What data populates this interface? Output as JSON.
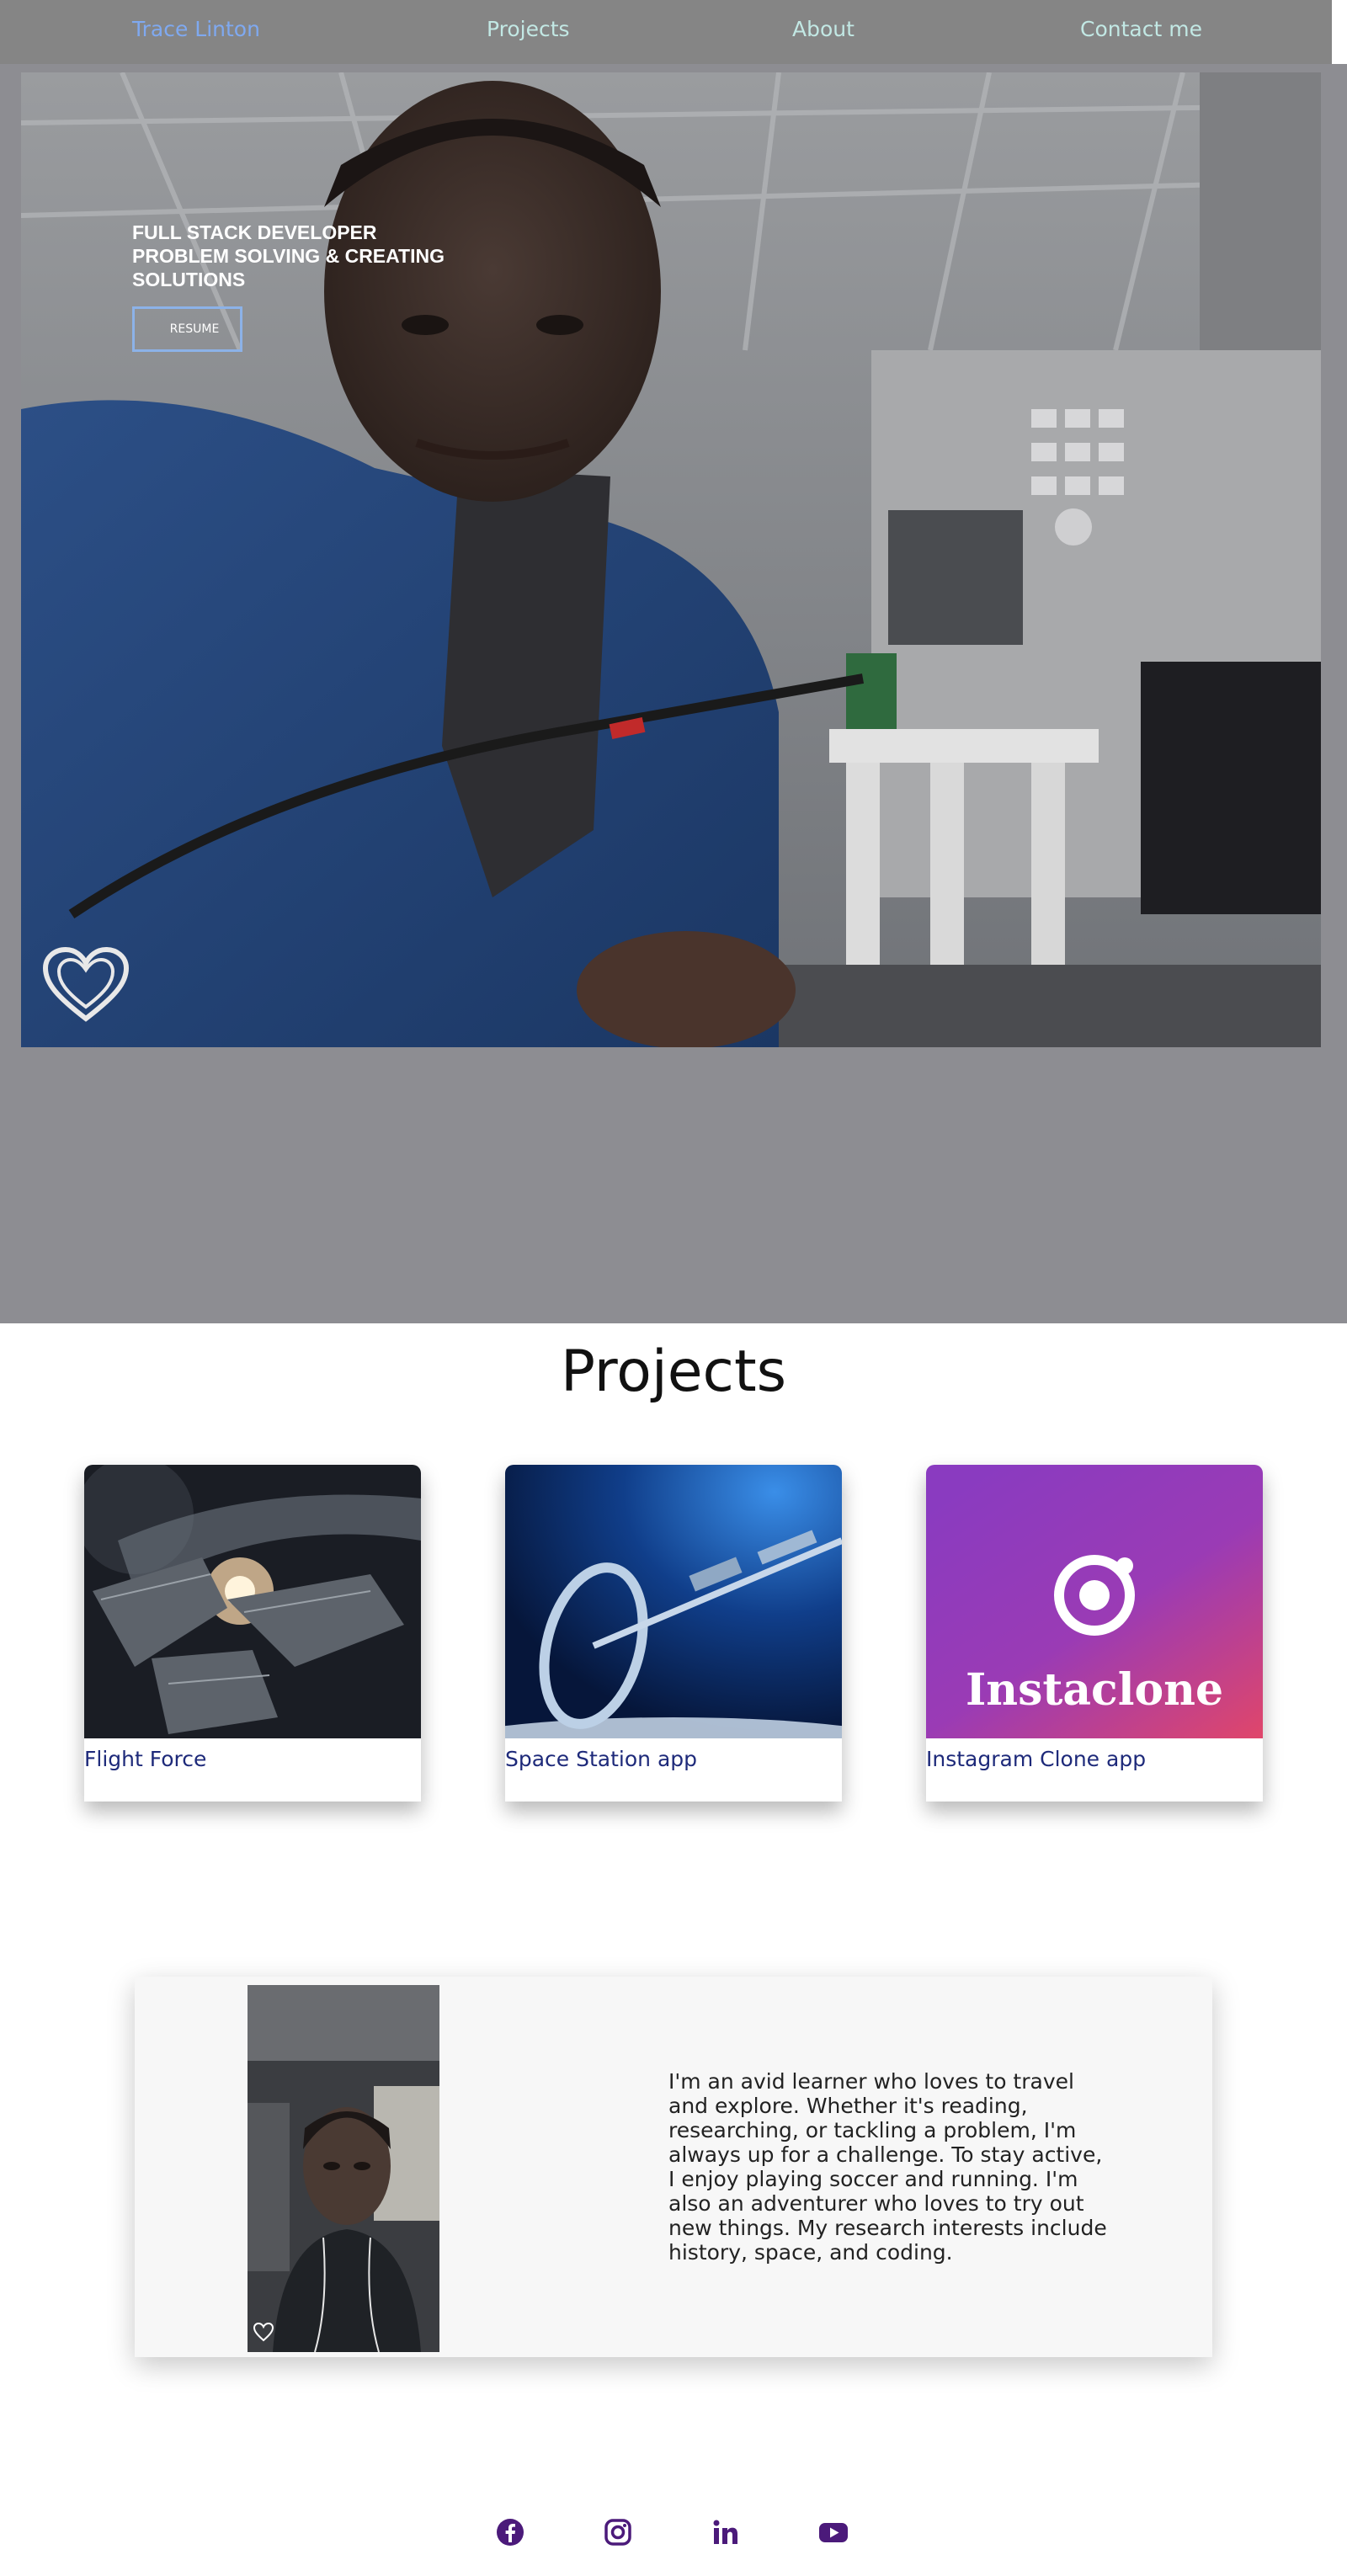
{
  "nav": {
    "brand": "Trace Linton",
    "projects": "Projects",
    "about": "About",
    "contact": "Contact me"
  },
  "hero": {
    "line1": "FULL STACK DEVELOPER",
    "line2": "PROBLEM SOLVING & CREATING",
    "line3": "SOLUTIONS",
    "resume_label": "RESUME",
    "photo_icon": "heart-outline-icon"
  },
  "projects": {
    "title": "Projects",
    "items": [
      {
        "title": "Flight Force",
        "image_icon": "spaceship-battle-image"
      },
      {
        "title": "Space Station app",
        "image_icon": "space-station-image"
      },
      {
        "title": "Instagram Clone app",
        "image_icon": "instaclone-logo-image",
        "logo_text": "Instaclone"
      }
    ]
  },
  "about": {
    "text": "I'm an avid learner who loves to travel and explore. Whether it's reading, researching, or tackling a problem, I'm always up for a challenge. To stay active, I enjoy playing soccer and running. I'm also an adventurer who loves to try out new things. My research interests include history, space, and coding."
  },
  "social": [
    {
      "name": "facebook-icon"
    },
    {
      "name": "instagram-icon"
    },
    {
      "name": "linkedin-icon"
    },
    {
      "name": "youtube-icon"
    }
  ],
  "colors": {
    "nav_bg": "#858585",
    "nav_link": "#c2e8e4",
    "brand": "#7fa9f0",
    "card_title": "#1e2a7a",
    "social_icon": "#4b1a7a"
  }
}
